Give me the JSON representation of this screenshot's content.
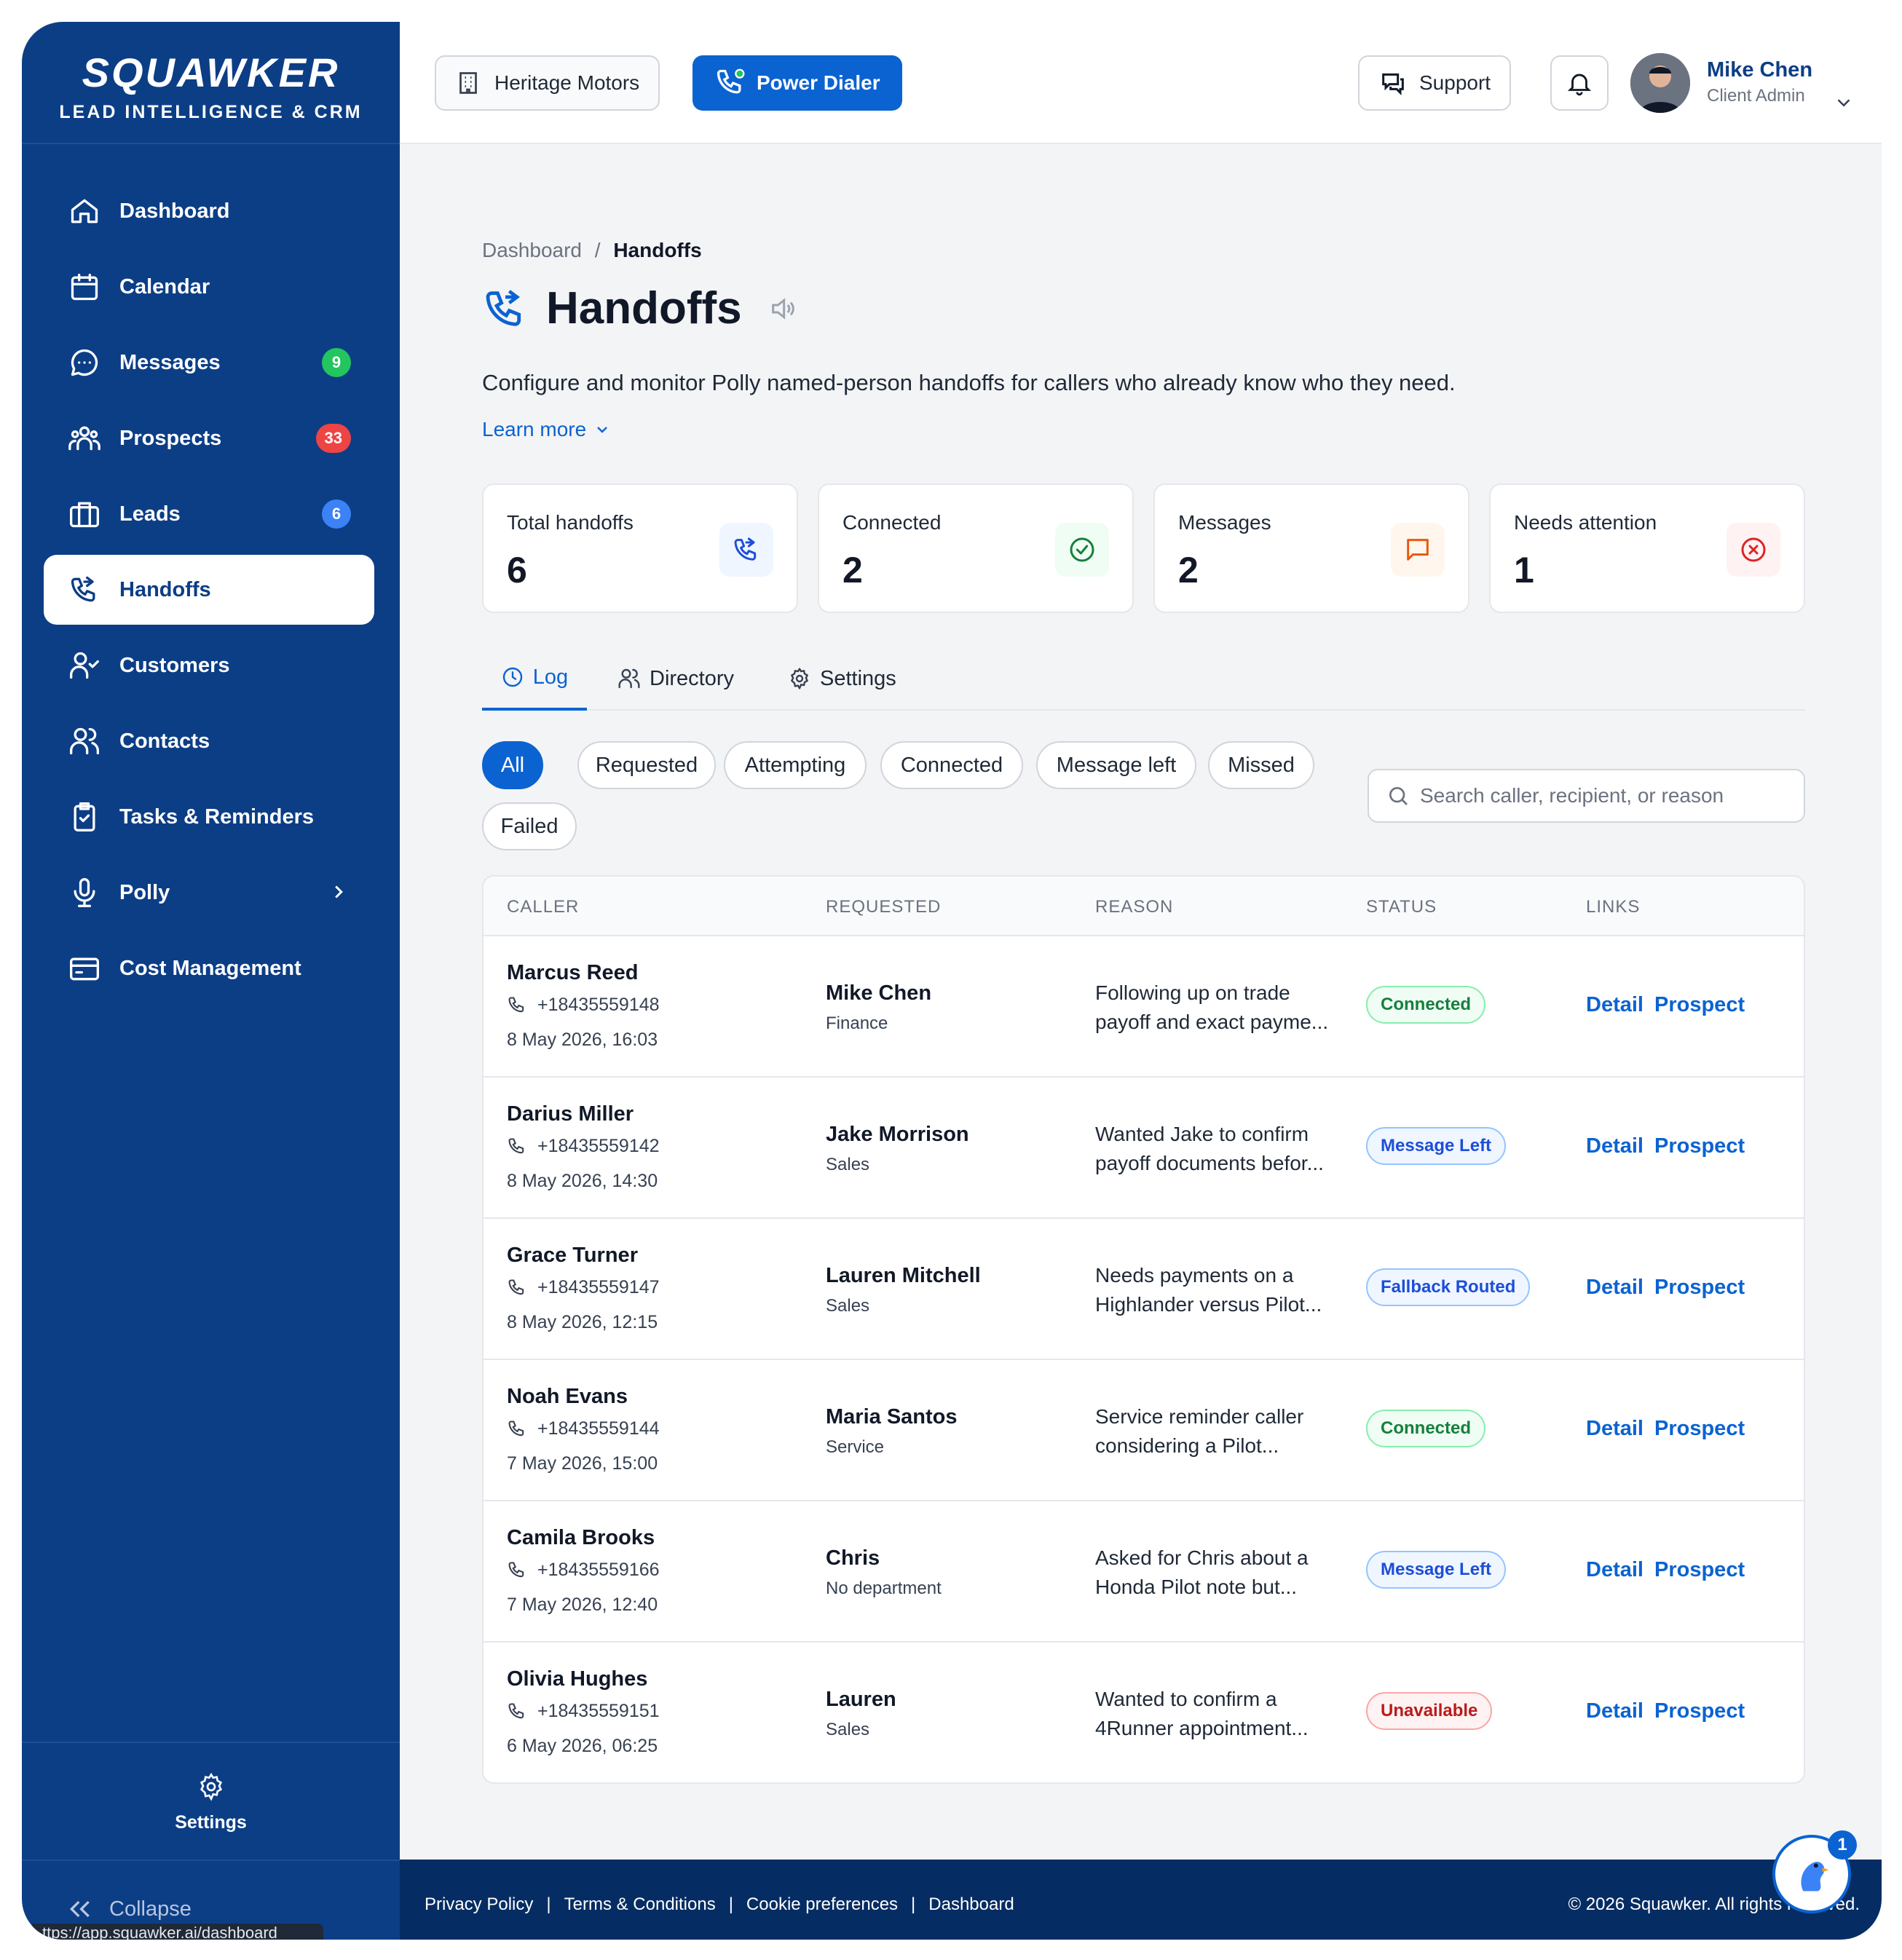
{
  "brand": {
    "logo": "SQUAWKER",
    "tagline": "LEAD INTELLIGENCE & CRM"
  },
  "sidebar": {
    "items": [
      {
        "label": "Dashboard",
        "icon": "home-icon"
      },
      {
        "label": "Calendar",
        "icon": "calendar-icon"
      },
      {
        "label": "Messages",
        "icon": "message-circle-icon",
        "badge": "9",
        "badge_color": "#22c55e"
      },
      {
        "label": "Prospects",
        "icon": "users-group-icon",
        "badge": "33",
        "badge_color": "#ef4444"
      },
      {
        "label": "Leads",
        "icon": "briefcase-icon",
        "badge": "6",
        "badge_color": "#3b82f6"
      },
      {
        "label": "Handoffs",
        "icon": "phone-forward-icon",
        "active": true
      },
      {
        "label": "Customers",
        "icon": "user-check-icon"
      },
      {
        "label": "Contacts",
        "icon": "users-icon"
      },
      {
        "label": "Tasks & Reminders",
        "icon": "clipboard-check-icon"
      },
      {
        "label": "Polly",
        "icon": "microphone-icon"
      },
      {
        "label": "Cost Management",
        "icon": "credit-card-icon"
      }
    ],
    "settings_label": "Settings",
    "collapse_label": "Collapse",
    "status_url": "ttps://app.squawker.ai/dashboard"
  },
  "topbar": {
    "dealer_label": "Heritage Motors",
    "dialer_label": "Power Dialer",
    "support_label": "Support",
    "user_name": "Mike Chen",
    "user_role": "Client Admin"
  },
  "page": {
    "breadcrumb_root": "Dashboard",
    "breadcrumb_sep": "/",
    "breadcrumb_current": "Handoffs",
    "title": "Handoffs",
    "subtitle": "Configure and monitor Polly named-person handoffs for callers who already know who they need.",
    "learn_more": "Learn more"
  },
  "stats": [
    {
      "label": "Total handoffs",
      "value": "6",
      "icon": "phone-forward-icon",
      "bg": "#eff6ff",
      "color": "#1d4ed8"
    },
    {
      "label": "Connected",
      "value": "2",
      "icon": "check-circle-icon",
      "bg": "#f0fdf4",
      "color": "#15803d"
    },
    {
      "label": "Messages",
      "value": "2",
      "icon": "message-square-icon",
      "bg": "#fff7ed",
      "color": "#ea580c"
    },
    {
      "label": "Needs attention",
      "value": "1",
      "icon": "x-circle-icon",
      "bg": "#fef2f2",
      "color": "#dc2626"
    }
  ],
  "tabs": [
    {
      "label": "Log",
      "icon": "clock-icon",
      "active": true
    },
    {
      "label": "Directory",
      "icon": "users-icon"
    },
    {
      "label": "Settings",
      "icon": "gear-icon"
    }
  ],
  "filters": [
    "All",
    "Requested",
    "Attempting",
    "Connected",
    "Message left",
    "Missed",
    "Failed"
  ],
  "search": {
    "placeholder": "Search caller, recipient, or reason"
  },
  "table": {
    "headers": [
      "CALLER",
      "REQUESTED",
      "REASON",
      "STATUS",
      "LINKS"
    ],
    "rows": [
      {
        "caller": "Marcus Reed",
        "phone": "+18435559148",
        "date": "8 May 2026, 16:03",
        "recipient": "Mike Chen",
        "dept": "Finance",
        "reason": "Following up on trade payoff and exact payme...",
        "status": "Connected",
        "status_type": "connected"
      },
      {
        "caller": "Darius Miller",
        "phone": "+18435559142",
        "date": "8 May 2026, 14:30",
        "recipient": "Jake Morrison",
        "dept": "Sales",
        "reason": "Wanted Jake to confirm payoff documents befor...",
        "status": "Message Left",
        "status_type": "left"
      },
      {
        "caller": "Grace Turner",
        "phone": "+18435559147",
        "date": "8 May 2026, 12:15",
        "recipient": "Lauren Mitchell",
        "dept": "Sales",
        "reason": "Needs payments on a Highlander versus Pilot...",
        "status": "Fallback Routed",
        "status_type": "left"
      },
      {
        "caller": "Noah Evans",
        "phone": "+18435559144",
        "date": "7 May 2026, 15:00",
        "recipient": "Maria Santos",
        "dept": "Service",
        "reason": "Service reminder caller considering a Pilot...",
        "status": "Connected",
        "status_type": "connected"
      },
      {
        "caller": "Camila Brooks",
        "phone": "+18435559166",
        "date": "7 May 2026, 12:40",
        "recipient": "Chris",
        "dept": "No department",
        "reason": "Asked for Chris about a Honda Pilot note but...",
        "status": "Message Left",
        "status_type": "left"
      },
      {
        "caller": "Olivia Hughes",
        "phone": "+18435559151",
        "date": "6 May 2026, 06:25",
        "recipient": "Lauren",
        "dept": "Sales",
        "reason": "Wanted to confirm a 4Runner appointment...",
        "status": "Unavailable",
        "status_type": "unavail"
      }
    ],
    "detail_label": "Detail",
    "prospect_label": "Prospect"
  },
  "footer": {
    "links": [
      "Privacy Policy",
      "Terms & Conditions",
      "Cookie preferences",
      "Dashboard"
    ],
    "copyright": "© 2026 Squawker. All rights reserved."
  },
  "chat_badge": "1"
}
